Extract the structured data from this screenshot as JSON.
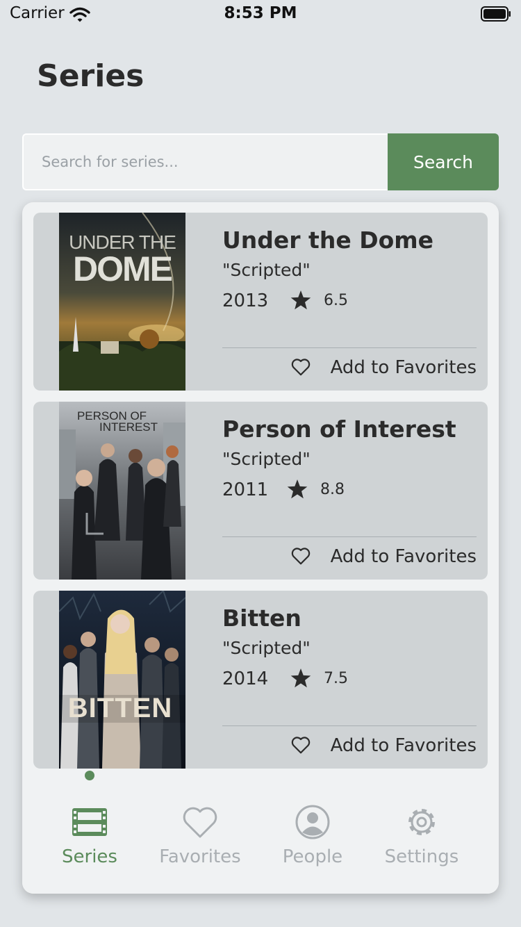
{
  "status_bar": {
    "carrier": "Carrier",
    "time": "8:53 PM"
  },
  "header": {
    "title": "Series"
  },
  "search": {
    "placeholder": "Search for series...",
    "button_label": "Search"
  },
  "series": [
    {
      "title": "Under the Dome",
      "genre": "\"Scripted\"",
      "year": "2013",
      "rating": "6.5",
      "favorite_label": "Add to Favorites",
      "poster_text": [
        "UNDER THE",
        "DOME"
      ]
    },
    {
      "title": "Person of Interest",
      "genre": "\"Scripted\"",
      "year": "2011",
      "rating": "8.8",
      "favorite_label": "Add to Favorites",
      "poster_text": [
        "PERSON OF",
        "INTEREST"
      ]
    },
    {
      "title": "Bitten",
      "genre": "\"Scripted\"",
      "year": "2014",
      "rating": "7.5",
      "favorite_label": "Add to Favorites",
      "poster_text": [
        "BITTEN"
      ]
    }
  ],
  "tab_bar": {
    "tabs": [
      {
        "label": "Series",
        "icon": "film-icon",
        "active": true
      },
      {
        "label": "Favorites",
        "icon": "heart-icon",
        "active": false
      },
      {
        "label": "People",
        "icon": "person-icon",
        "active": false
      },
      {
        "label": "Settings",
        "icon": "gear-icon",
        "active": false
      }
    ]
  },
  "colors": {
    "accent": "#5b8b5b",
    "background": "#e1e5e8",
    "card": "#cfd3d5",
    "inactive_tab": "#a9aeb2"
  }
}
